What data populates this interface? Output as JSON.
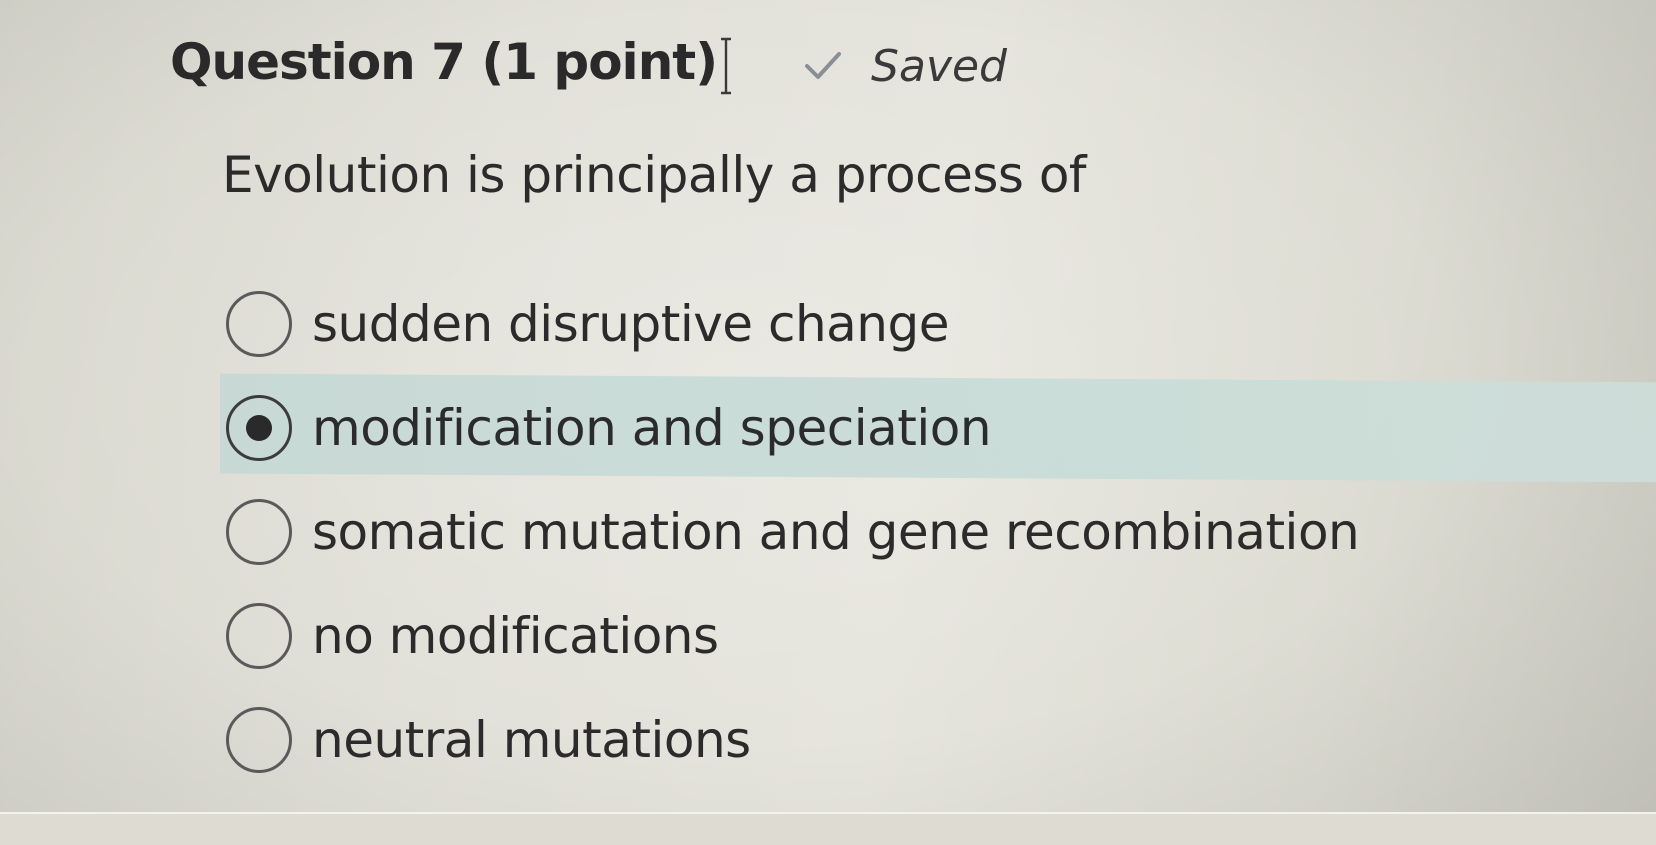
{
  "header": {
    "title": "Question 7 (1 point)",
    "status_label": "Saved",
    "status_icon": "checkmark-icon",
    "status_icon_color": "#8a8f95"
  },
  "question": {
    "prompt": "Evolution is principally a process of"
  },
  "options": [
    {
      "label": "sudden disruptive change",
      "selected": false
    },
    {
      "label": "modification and speciation",
      "selected": true
    },
    {
      "label": "somatic mutation and gene recombination",
      "selected": false
    },
    {
      "label": "no modifications",
      "selected": false
    },
    {
      "label": "neutral mutations",
      "selected": false
    }
  ],
  "colors": {
    "selected_row": "#c8dcd8",
    "text": "#2b2b2b",
    "background": "#e3e2da"
  }
}
